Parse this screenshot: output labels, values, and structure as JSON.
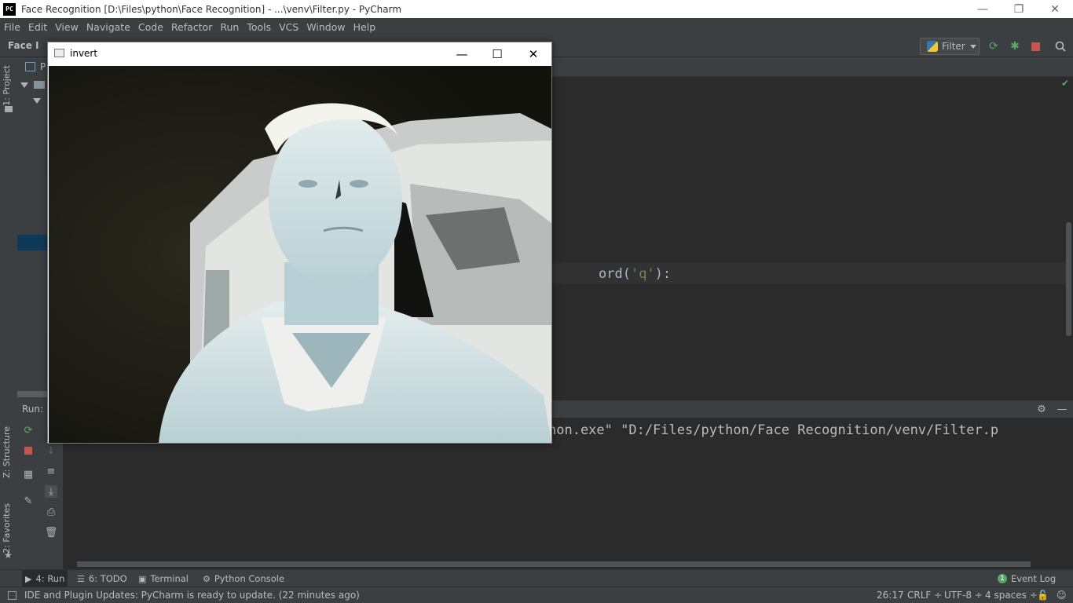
{
  "ide": {
    "title": "Face Recognition [D:\\Files\\python\\Face Recognition] - ...\\venv\\Filter.py - PyCharm",
    "logo_text": "PC",
    "window_controls": {
      "minimize": "—",
      "restore": "❐",
      "close": "✕"
    },
    "menu": [
      "File",
      "Edit",
      "View",
      "Navigate",
      "Code",
      "Refactor",
      "Run",
      "Tools",
      "VCS",
      "Window",
      "Help"
    ],
    "breadcrumb": "Face I",
    "run_config": "Filter",
    "left_tabs": {
      "project": "1: Project",
      "structure": "Z: Structure",
      "favorites": "2: Favorites"
    },
    "project_tab_partial": "P"
  },
  "editor": {
    "code_fn": "ord(",
    "code_str": "'q'",
    "code_tail": "):",
    "check_icon": "✔"
  },
  "run": {
    "label": "Run:",
    "console_text": "hon.exe\" \"D:/Files/python/Face Recognition/venv/Filter.p"
  },
  "bottom_tabs": {
    "run": "4: Run",
    "todo": "6: TODO",
    "terminal": "Terminal",
    "python_console": "Python Console",
    "event_log": "Event Log",
    "event_count": "1"
  },
  "status": {
    "message": "IDE and Plugin Updates: PyCharm is ready to update. (22 minutes ago)",
    "position": "26:17",
    "line_sep": "CRLF ÷",
    "encoding": "UTF-8 ÷",
    "indent": "4 spaces ÷"
  },
  "cv_window": {
    "title": "invert",
    "controls": {
      "minimize": "—",
      "maximize": "☐",
      "close": "✕"
    }
  },
  "colors": {
    "ide_bg": "#2b2b2b",
    "panel_bg": "#3c3f41",
    "accent_green": "#59a869",
    "stop_red": "#c75450",
    "selection": "#0d3a58"
  }
}
